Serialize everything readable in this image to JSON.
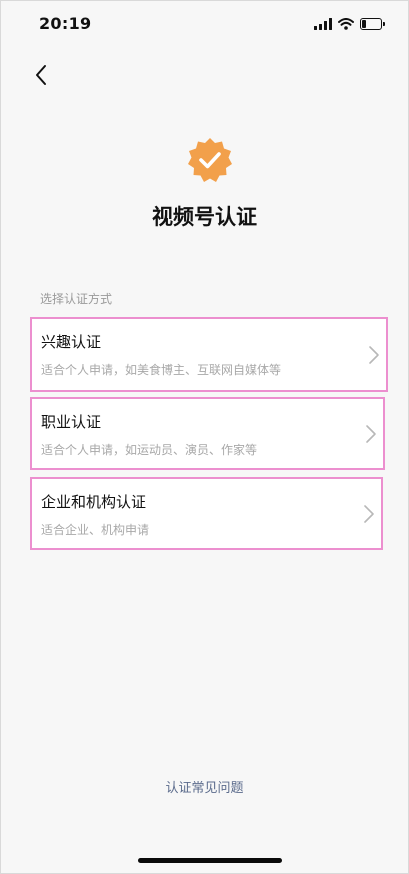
{
  "status_bar": {
    "time": "20:19"
  },
  "header": {
    "title": "视频号认证"
  },
  "section_label": "选择认证方式",
  "options": [
    {
      "title": "兴趣认证",
      "description": "适合个人申请，如美食博主、互联网自媒体等"
    },
    {
      "title": "职业认证",
      "description": "适合个人申请，如运动员、演员、作家等"
    },
    {
      "title": "企业和机构认证",
      "description": "适合企业、机构申请"
    }
  ],
  "footer": {
    "faq_link": "认证常见问题"
  },
  "colors": {
    "badge": "#f2a04b",
    "highlight_border": "#ec8fcf",
    "link": "#5b6b8c",
    "background": "#f7f7f7"
  },
  "icons": {
    "back": "chevron-left-icon",
    "badge": "verified-badge-icon",
    "chevron": "chevron-right-icon",
    "signal": "cellular-signal-icon",
    "wifi": "wifi-icon",
    "battery": "battery-icon"
  }
}
